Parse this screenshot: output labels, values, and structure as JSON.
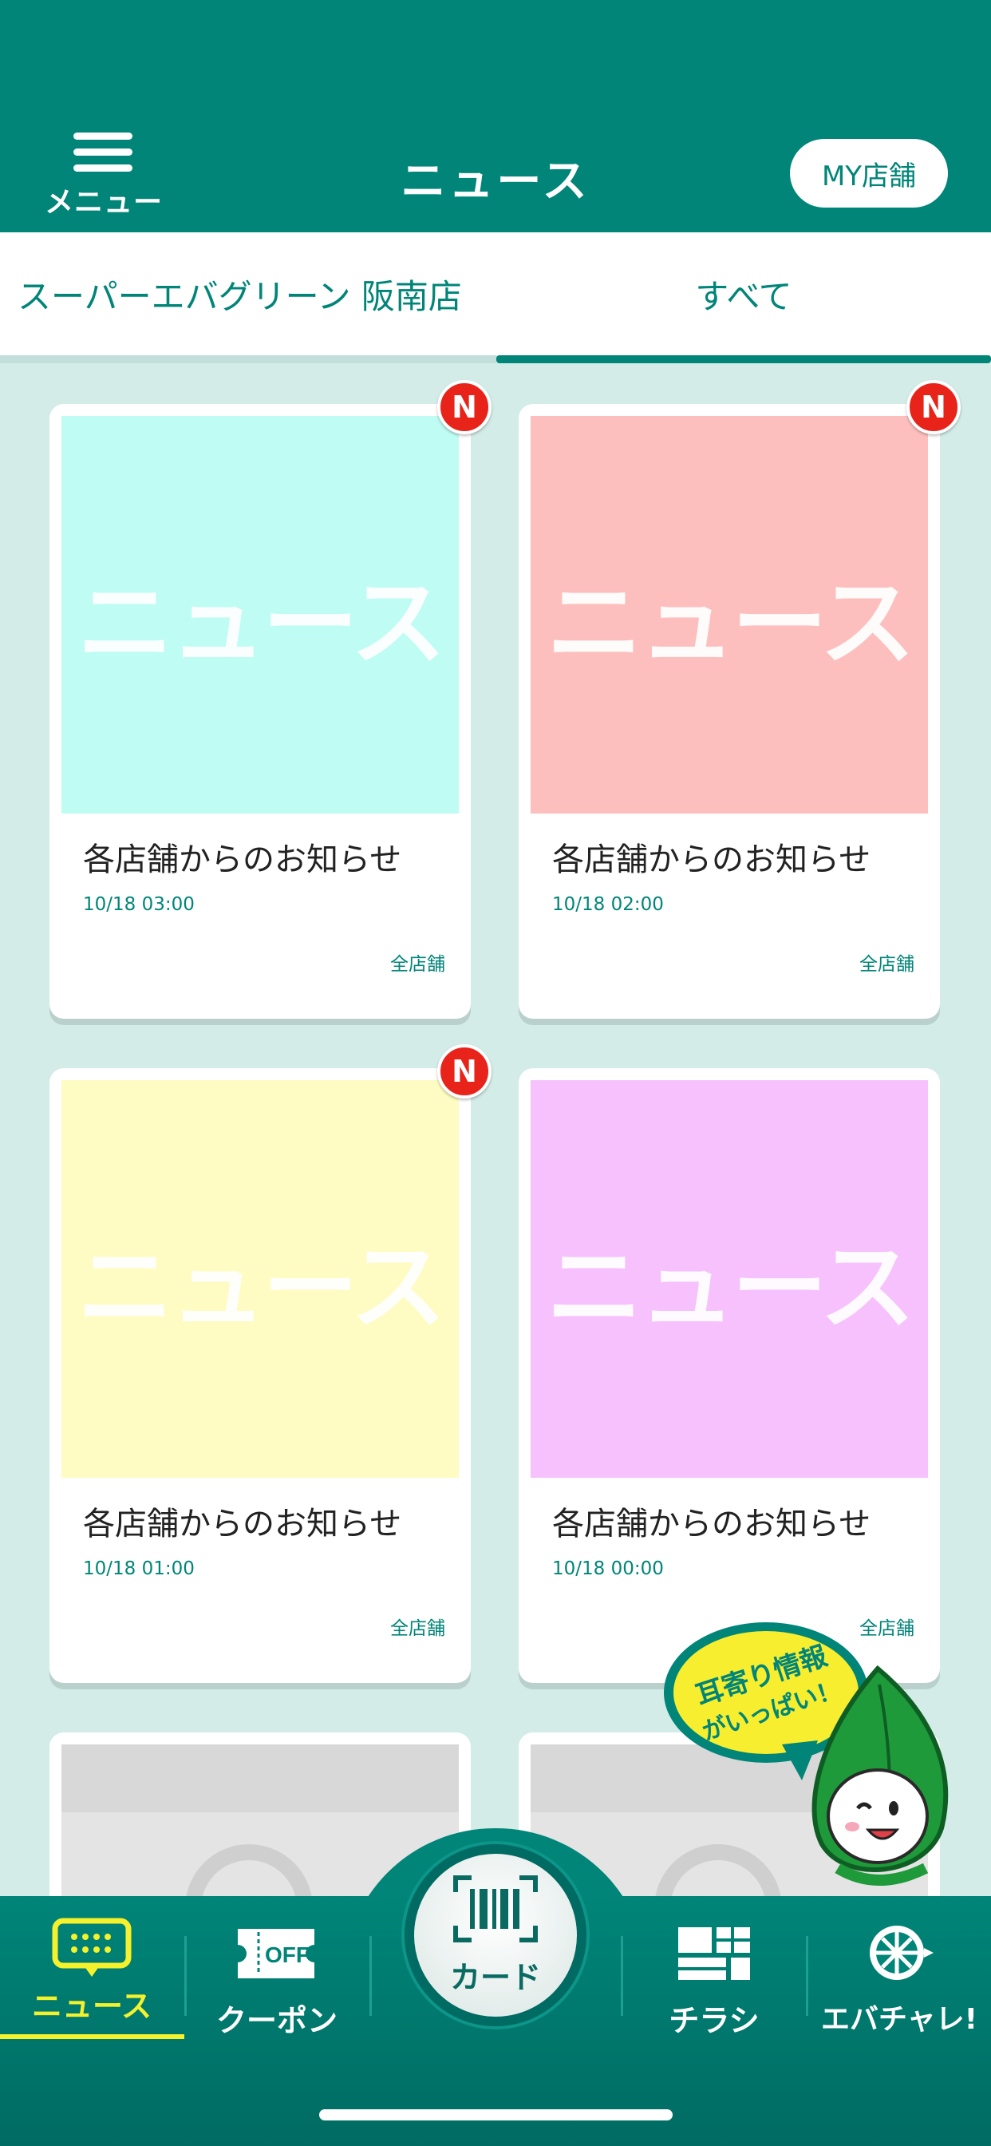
{
  "header": {
    "menu_label": "メニュー",
    "title": "ニュース",
    "my_store_label": "MY店舗"
  },
  "tabs": [
    {
      "label": "スーパーエバグリーン 阪南店",
      "active": false
    },
    {
      "label": "すべて",
      "active": true
    }
  ],
  "cards": [
    {
      "thumb_text": "ニュース",
      "thumb_color": "#befcf4",
      "title": "各店舗からのお知らせ",
      "date": "10/18 03:00",
      "store": "全店舗",
      "badge": "N"
    },
    {
      "thumb_text": "ニュース",
      "thumb_color": "#fdbfbe",
      "title": "各店舗からのお知らせ",
      "date": "10/18 02:00",
      "store": "全店舗",
      "badge": "N"
    },
    {
      "thumb_text": "ニュース",
      "thumb_color": "#fefcc2",
      "title": "各店舗からのお知らせ",
      "date": "10/18 01:00",
      "store": "全店舗",
      "badge": "N"
    },
    {
      "thumb_text": "ニュース",
      "thumb_color": "#f6c1fc",
      "title": "各店舗からのお知らせ",
      "date": "10/18 00:00",
      "store": "全店舗",
      "badge": ""
    }
  ],
  "mascot": {
    "speech_line1": "耳寄り情報",
    "speech_line2": "がいっぱい！"
  },
  "bottom_nav": {
    "items": [
      {
        "label": "ニュース",
        "icon": "news-icon",
        "active": true
      },
      {
        "label": "クーポン",
        "icon": "coupon-off-icon",
        "icon_text": "OFF",
        "active": false
      },
      {
        "label": "カード",
        "icon": "barcode-icon",
        "active": false
      },
      {
        "label": "チラシ",
        "icon": "flyer-icon",
        "active": false
      },
      {
        "label": "エバチャレ!",
        "icon": "wheel-icon",
        "active": false
      }
    ]
  },
  "colors": {
    "primary": "#008578",
    "background": "#d3ece8",
    "active_nav": "#f5f12c",
    "badge": "#e8231a"
  }
}
